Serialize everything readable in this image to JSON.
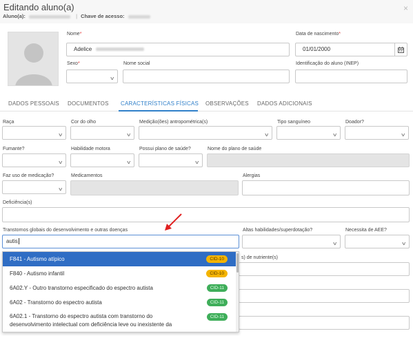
{
  "header": {
    "title": "Editando aluno(a)",
    "aluno_label": "Aluno(a):",
    "chave_label": "Chave de acesso:",
    "close_glyph": "×"
  },
  "form": {
    "nome_label": "Nome",
    "nome_value": "Adelice",
    "nascimento_label": "Data de nascimento",
    "nascimento_value": "01/01/2000",
    "sexo_label": "Sexo",
    "nome_social_label": "Nome social",
    "inep_label": "Identificação do aluno (INEP)",
    "required_mark": "*"
  },
  "tabs": [
    {
      "label": "DADOS PESSOAIS"
    },
    {
      "label": "DOCUMENTOS"
    },
    {
      "label": "CARACTERÍSTICAS FÍSICAS"
    },
    {
      "label": "OBSERVAÇÕES"
    },
    {
      "label": "DADOS ADICIONAIS"
    }
  ],
  "fields": {
    "raca": "Raça",
    "cor_olho": "Cor do olho",
    "medicao": "Medição(ões) antropométrica(s)",
    "tipo_sanguineo": "Tipo sanguíneo",
    "doador": "Doador?",
    "fumante": "Fumante?",
    "habilidade_motora": "Habilidade motora",
    "plano_saude": "Possui plano de saúde?",
    "nome_plano": "Nome do plano de saúde",
    "uso_medicacao": "Faz uso de medicação?",
    "medicamentos": "Medicamentos",
    "alergias": "Alergias",
    "deficiencia": "Deficiência(s)",
    "transtornos": "Transtornos globais do desenvolvimento e outras doenças",
    "transtornos_value": "autis",
    "altas_habilidades": "Altas habilidades/superdotação?",
    "necessita_aee": "Necessita de AEE?",
    "nutriente_partial": "s) de nutriente(s)"
  },
  "dropdown": [
    {
      "label": "F841 - Autismo atípico",
      "badge": "CID-10"
    },
    {
      "label": "F840 - Autismo infantil",
      "badge": "CID-10"
    },
    {
      "label": "6A02.Y - Outro transtorno especificado do espectro autista",
      "badge": "CID-11"
    },
    {
      "label": "6A02 - Transtorno do espectro autista",
      "badge": "CID-11"
    },
    {
      "label": "6A02.1 - Transtorno do espectro autista com transtorno do",
      "label2": "desenvolvimento intelectual com deficiência leve ou inexistente da",
      "badge": "CID-11"
    }
  ],
  "colors": {
    "accent": "#2f7fc9",
    "selected_row": "#2f6dc4",
    "arrow": "#e02020",
    "cid10": "#f4b400",
    "cid11": "#3fae5a"
  },
  "icons": {
    "close": "close-icon",
    "calendar": "calendar-icon",
    "chevron": "chevron-down-icon",
    "avatar": "avatar-placeholder-icon",
    "annotation": "red-arrow-annotation"
  }
}
